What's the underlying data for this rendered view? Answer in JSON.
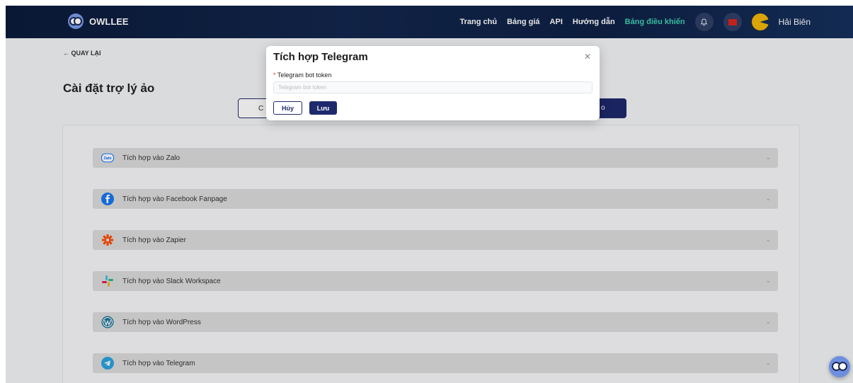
{
  "header": {
    "brand": "OWLLEE",
    "nav": [
      "Trang chủ",
      "Bảng giá",
      "API",
      "Hướng dẫn",
      "Bảng điều khiển"
    ],
    "user_name": "Hải Biên"
  },
  "page": {
    "back_label": "← QUAY LẠI",
    "title": "Cài đặt trợ lý ảo",
    "tab_left_label": "C",
    "tab_right_label": "o"
  },
  "integrations": [
    {
      "label": "Tích hợp vào Zalo",
      "icon": "zalo-icon"
    },
    {
      "label": "Tích hợp vào Facebook Fanpage",
      "icon": "facebook-icon"
    },
    {
      "label": "Tích hợp vào Zapier",
      "icon": "zapier-icon"
    },
    {
      "label": "Tích hợp vào Slack Workspace",
      "icon": "slack-icon"
    },
    {
      "label": "Tích hợp vào WordPress",
      "icon": "wordpress-icon"
    },
    {
      "label": "Tích hợp vào Telegram",
      "icon": "telegram-icon"
    }
  ],
  "modal": {
    "title": "Tích hợp Telegram",
    "field_label": "Telegram bot token",
    "field_placeholder": "Telegram bot token",
    "field_value": "",
    "cancel_label": "Hủy",
    "save_label": "Lưu"
  },
  "zalo_mark": "Zalo",
  "colors": {
    "primary": "#1e2a6b",
    "active_nav": "#3fd0b0",
    "facebook": "#1877f2",
    "zapier": "#ff4a00",
    "wordpress": "#21759b",
    "telegram": "#2aa3de"
  }
}
